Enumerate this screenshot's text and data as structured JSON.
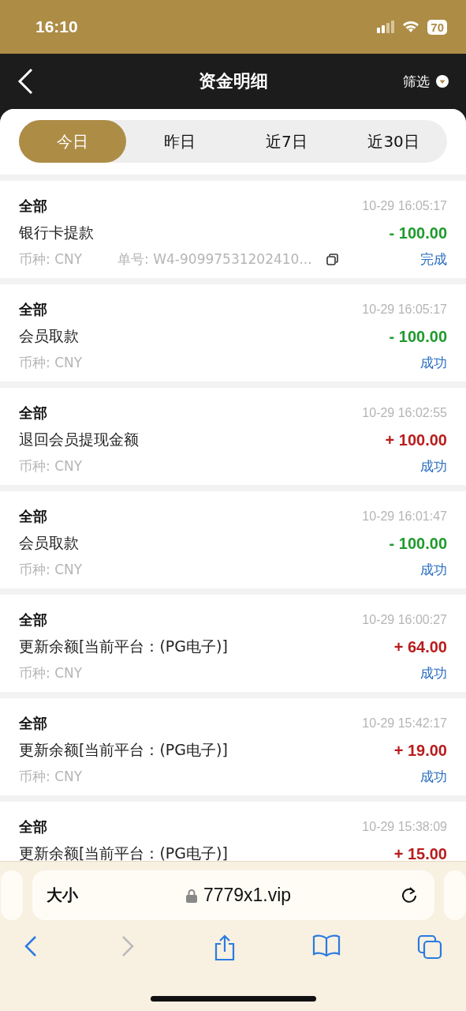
{
  "status_bar": {
    "time": "16:10",
    "battery": "70"
  },
  "header": {
    "title": "资金明细",
    "filter": "筛选"
  },
  "tabs": [
    {
      "label": "今日",
      "selected": true
    },
    {
      "label": "昨日",
      "selected": false
    },
    {
      "label": "近7日",
      "selected": false
    },
    {
      "label": "近30日",
      "selected": false
    }
  ],
  "records": [
    {
      "category": "全部",
      "time": "10-29 16:05:17",
      "title": "银行卡提款",
      "amount": "- 100.00",
      "color": "#1f9a2d",
      "currency": "币种: CNY",
      "order_no": "单号: W4-90997531202410...",
      "status": "完成"
    },
    {
      "category": "全部",
      "time": "10-29 16:05:17",
      "title": "会员取款",
      "amount": "- 100.00",
      "color": "#1f9a2d",
      "currency": "币种: CNY",
      "status": "成功"
    },
    {
      "category": "全部",
      "time": "10-29 16:02:55",
      "title": "退回会员提现金额",
      "amount": "+ 100.00",
      "color": "#b81c1c",
      "currency": "币种: CNY",
      "status": "成功"
    },
    {
      "category": "全部",
      "time": "10-29 16:01:47",
      "title": "会员取款",
      "amount": "- 100.00",
      "color": "#1f9a2d",
      "currency": "币种: CNY",
      "status": "成功"
    },
    {
      "category": "全部",
      "time": "10-29 16:00:27",
      "title": "更新余额[当前平台：(PG电子)]",
      "amount": "+ 64.00",
      "color": "#b81c1c",
      "currency": "币种: CNY",
      "status": "成功"
    },
    {
      "category": "全部",
      "time": "10-29 15:42:17",
      "title": "更新余额[当前平台：(PG电子)]",
      "amount": "+ 19.00",
      "color": "#b81c1c",
      "currency": "币种: CNY",
      "status": "成功"
    },
    {
      "category": "全部",
      "time": "10-29 15:38:09",
      "title": "更新余额[当前平台：(PG电子)]",
      "amount": "+ 15.00",
      "color": "#b81c1c"
    }
  ],
  "browser": {
    "text_size": "大小",
    "url": "7779x1.vip"
  }
}
